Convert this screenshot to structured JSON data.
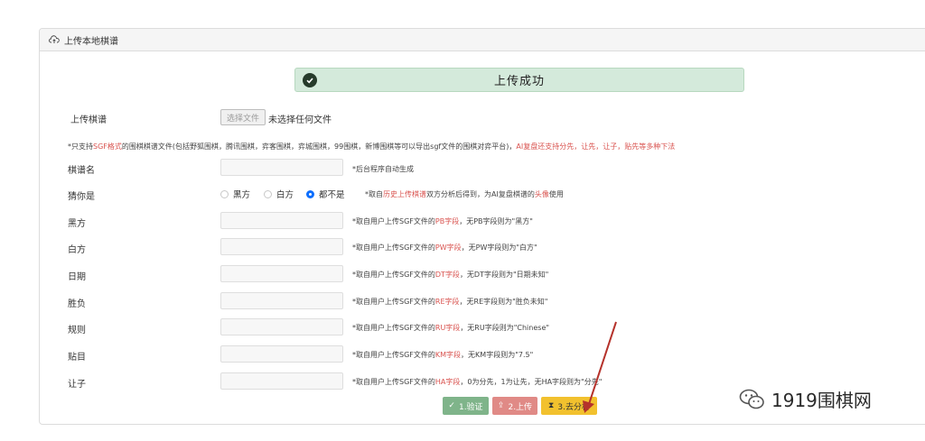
{
  "panel": {
    "title": "上传本地棋谱",
    "icon": "cloud-upload-icon"
  },
  "alert": {
    "message": "上传成功",
    "icon": "check-circle-icon"
  },
  "upload": {
    "label": "上传棋谱",
    "button": "选择文件",
    "status": "未选择任何文件"
  },
  "notice": {
    "part1": "*只支持",
    "part2": "SGF格式",
    "part3": "的围棋棋谱文件(包括野狐围棋，腾讯围棋，弈客围棋，弈城围棋，99围棋，新博围棋等可以导出sgf文件的围棋对弈平台)，",
    "part4": "AI复盘还支持分先，让先，让子，贴先等多种下法"
  },
  "fields": {
    "name": {
      "label": "棋谱名",
      "hint": "*后台程序自动生成"
    },
    "black": {
      "label": "黑方",
      "hint_a": "*取自用户上传SGF文件的",
      "hint_red": "PB字段",
      "hint_b": "，无PB字段则为\"黑方\""
    },
    "white": {
      "label": "白方",
      "hint_a": "*取自用户上传SGF文件的",
      "hint_red": "PW字段",
      "hint_b": "，无PW字段则为\"白方\""
    },
    "date": {
      "label": "日期",
      "hint_a": "*取自用户上传SGF文件的",
      "hint_red": "DT字段",
      "hint_b": "，无DT字段则为\"日期未知\""
    },
    "result": {
      "label": "胜负",
      "hint_a": "*取自用户上传SGF文件的",
      "hint_red": "RE字段",
      "hint_b": "，无RE字段则为\"胜负未知\""
    },
    "rule": {
      "label": "规则",
      "hint_a": "*取自用户上传SGF文件的",
      "hint_red": "RU字段",
      "hint_b": "，无RU字段则为\"Chinese\""
    },
    "komi": {
      "label": "贴目",
      "hint_a": "*取自用户上传SGF文件的",
      "hint_red": "KM字段",
      "hint_b": "，无KM字段则为\"7.5\""
    },
    "handicap": {
      "label": "让子",
      "hint_a": "*取自用户上传SGF文件的",
      "hint_red": "HA字段",
      "hint_b": "，0为分先，1为让先，无HA字段则为\"分先\""
    }
  },
  "guess": {
    "label": "猜你是",
    "options": [
      "黑方",
      "白方",
      "都不是"
    ],
    "selected": "都不是",
    "hint_a": "*取自",
    "hint_red1": "历史上传棋谱",
    "hint_b": "双方分析后得到，为AI复盘棋谱的",
    "hint_red2": "头像",
    "hint_c": "使用"
  },
  "buttons": {
    "verify": "1.验证",
    "upload": "2.上传",
    "analyze": "3.去分析"
  },
  "watermark": {
    "text": "1919围棋网"
  },
  "colors": {
    "success_bg": "#d4eadb",
    "verify": "#7fb48a",
    "upload": "#e08a86",
    "analyze": "#f2c12e",
    "accent_red": "#d9534f",
    "radio_on": "#0d6efd",
    "arrow": "#b5322b"
  }
}
